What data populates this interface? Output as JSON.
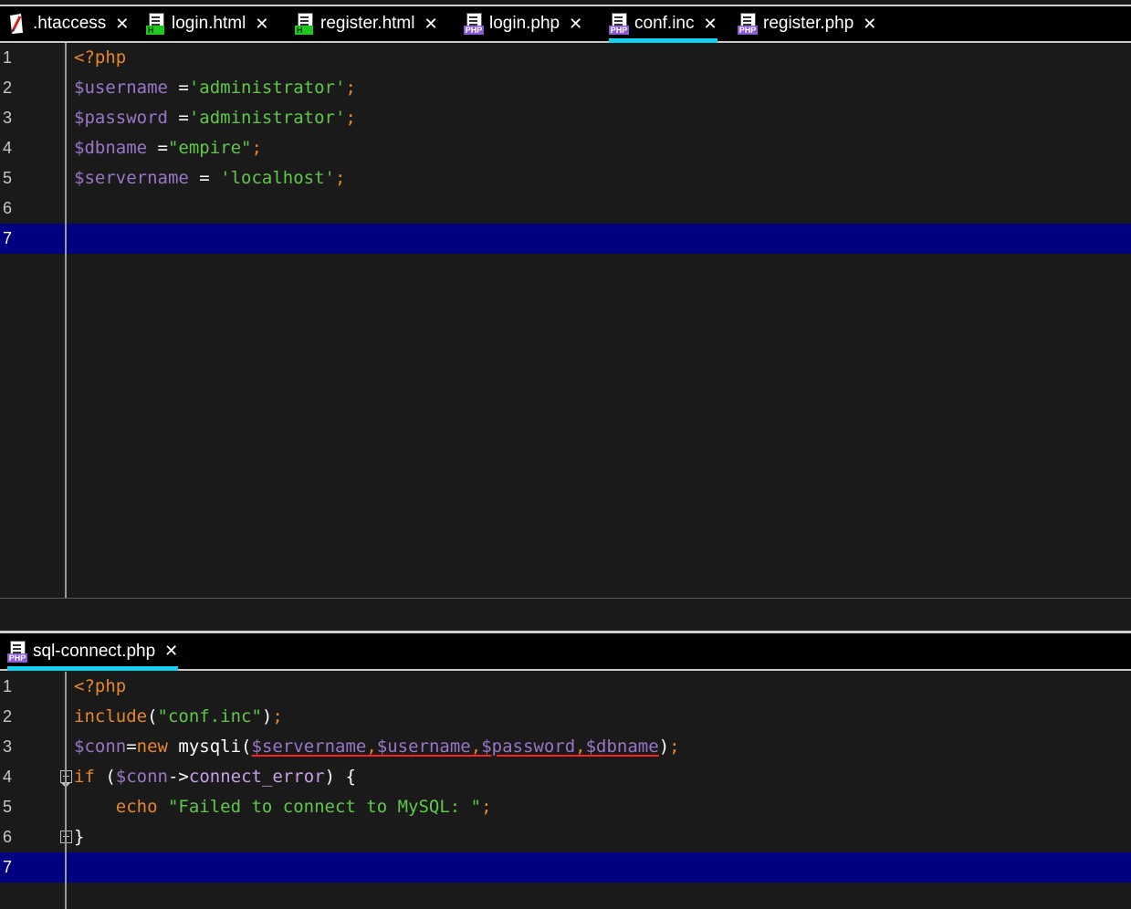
{
  "top_tabs": [
    {
      "label": ".htaccess",
      "icon": "htaccess-icon",
      "active": false
    },
    {
      "label": "login.html",
      "icon": "html-file-icon",
      "badge": "H",
      "active": false
    },
    {
      "label": "register.html",
      "icon": "html-file-icon",
      "badge": "H",
      "active": false
    },
    {
      "label": "login.php",
      "icon": "php-file-icon",
      "badge": "PHP",
      "active": false
    },
    {
      "label": "conf.inc",
      "icon": "php-file-icon",
      "badge": "PHP",
      "active": true
    },
    {
      "label": "register.php",
      "icon": "php-file-icon",
      "badge": "PHP",
      "active": false
    }
  ],
  "bottom_tabs": [
    {
      "label": "sql-connect.php",
      "icon": "php-file-icon",
      "badge": "PHP",
      "active": true
    }
  ],
  "close_glyph": "✕",
  "top_editor": {
    "current_line": 7,
    "lines": [
      {
        "n": "1",
        "tokens": [
          {
            "t": "<?php",
            "c": "kw"
          }
        ]
      },
      {
        "n": "2",
        "tokens": [
          {
            "t": "$username",
            "c": "var"
          },
          {
            "t": " =",
            "c": "op"
          },
          {
            "t": "'administrator'",
            "c": "str"
          },
          {
            "t": ";",
            "c": "pun"
          }
        ]
      },
      {
        "n": "3",
        "tokens": [
          {
            "t": "$password",
            "c": "var"
          },
          {
            "t": " =",
            "c": "op"
          },
          {
            "t": "'administrator'",
            "c": "str"
          },
          {
            "t": ";",
            "c": "pun"
          }
        ]
      },
      {
        "n": "4",
        "tokens": [
          {
            "t": "$dbname",
            "c": "var"
          },
          {
            "t": " =",
            "c": "op"
          },
          {
            "t": "\"empire\"",
            "c": "str"
          },
          {
            "t": ";",
            "c": "pun"
          }
        ]
      },
      {
        "n": "5",
        "tokens": [
          {
            "t": "$servername",
            "c": "var"
          },
          {
            "t": " = ",
            "c": "op"
          },
          {
            "t": "'localhost'",
            "c": "str"
          },
          {
            "t": ";",
            "c": "pun"
          }
        ]
      },
      {
        "n": "6",
        "tokens": []
      },
      {
        "n": "7",
        "tokens": []
      }
    ]
  },
  "bottom_editor": {
    "current_line": 7,
    "lines": [
      {
        "n": "1",
        "tokens": [
          {
            "t": "<?php",
            "c": "kw"
          }
        ]
      },
      {
        "n": "2",
        "tokens": [
          {
            "t": "include",
            "c": "kw"
          },
          {
            "t": "(",
            "c": "op"
          },
          {
            "t": "\"conf.inc\"",
            "c": "str"
          },
          {
            "t": ")",
            "c": "op"
          },
          {
            "t": ";",
            "c": "pun"
          }
        ]
      },
      {
        "n": "3",
        "tokens": [
          {
            "t": "$conn",
            "c": "var"
          },
          {
            "t": "=",
            "c": "op"
          },
          {
            "t": "new",
            "c": "kw"
          },
          {
            "t": " mysqli(",
            "c": "fn"
          },
          {
            "t": "$servername",
            "c": "var err"
          },
          {
            "t": ",",
            "c": "pun err"
          },
          {
            "t": "$username",
            "c": "var err"
          },
          {
            "t": ",",
            "c": "pun err"
          },
          {
            "t": "$password",
            "c": "var err"
          },
          {
            "t": ",",
            "c": "pun err"
          },
          {
            "t": "$dbname",
            "c": "var err"
          },
          {
            "t": ")",
            "c": "op"
          },
          {
            "t": ";",
            "c": "pun"
          }
        ]
      },
      {
        "n": "4",
        "fold": "open",
        "tokens": [
          {
            "t": "if",
            "c": "kw"
          },
          {
            "t": " (",
            "c": "op"
          },
          {
            "t": "$conn",
            "c": "var"
          },
          {
            "t": "->",
            "c": "op"
          },
          {
            "t": "connect_error",
            "c": "prop"
          },
          {
            "t": ") {",
            "c": "op"
          }
        ]
      },
      {
        "n": "5",
        "tokens": [
          {
            "t": "    echo ",
            "c": "kw"
          },
          {
            "t": "\"Failed to connect to MySQL: \"",
            "c": "str"
          },
          {
            "t": ";",
            "c": "pun"
          }
        ]
      },
      {
        "n": "6",
        "fold": "close",
        "tokens": [
          {
            "t": "}",
            "c": "op"
          }
        ]
      },
      {
        "n": "7",
        "tokens": []
      }
    ]
  }
}
